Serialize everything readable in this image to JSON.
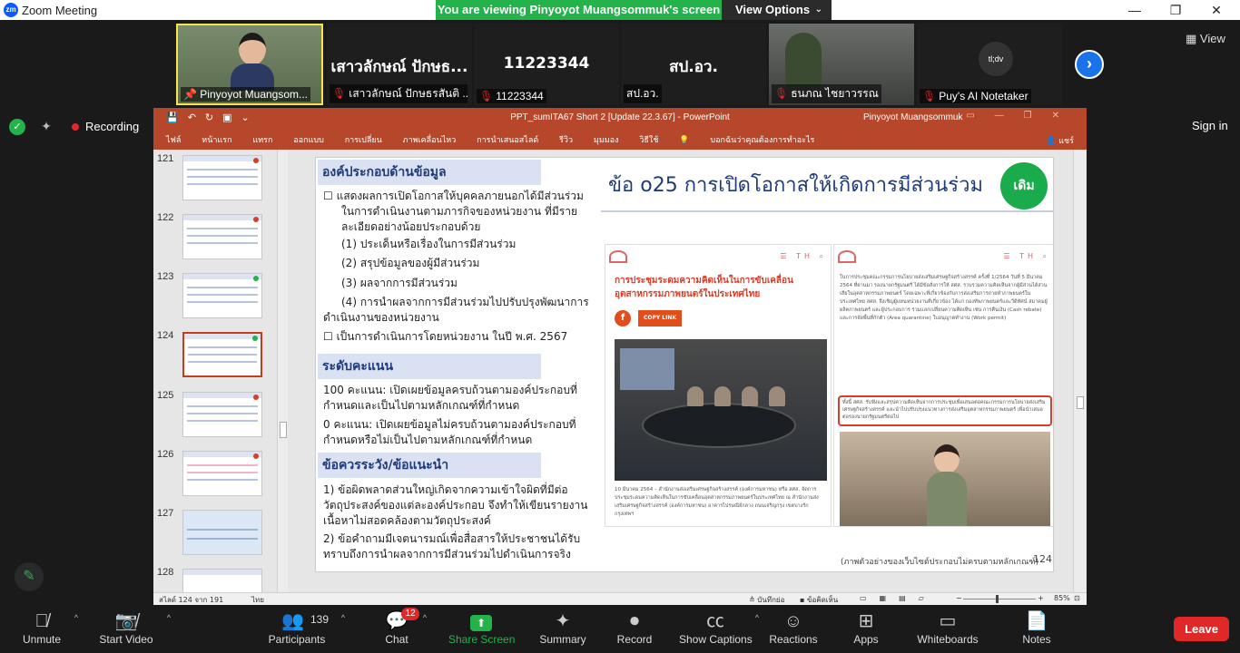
{
  "window": {
    "title": "Zoom Meeting",
    "app_icon": "zm",
    "viewing_banner": "You are viewing Pinyoyot Muangsommuk's screen",
    "view_options": "View Options"
  },
  "participants_strip": [
    {
      "name": "Pinyoyot Muangsom...",
      "big_name": "",
      "muted": false
    },
    {
      "name": "เสาวลักษณ์ ปักษธรสันติ ...",
      "big_name": "เสาวลักษณ์ ปักษธ...",
      "muted": true
    },
    {
      "name": "11223344",
      "big_name": "11223344",
      "muted": true
    },
    {
      "name": "สป.อว.",
      "big_name": "สป.อว.",
      "muted": false
    },
    {
      "name": "ธนภณ ไชยาวรรณ",
      "big_name": "",
      "muted": true
    },
    {
      "name": "Puy's AI Notetaker",
      "big_name": "",
      "muted": true,
      "avatar_text": "tl;dv"
    }
  ],
  "view_button": "View",
  "recording_label": "Recording",
  "sign_in": "Sign in",
  "powerpoint": {
    "doc_title": "PPT_sumITA67 Short 2 [Update 22.3.67]  -  PowerPoint",
    "user": "Pinyoyot Muangsommuk",
    "ribbon_tabs": [
      "ไฟล์",
      "หน้าแรก",
      "แทรก",
      "ออกแบบ",
      "การเปลี่ยน",
      "ภาพเคลื่อนไหว",
      "การนำเสนอสไลด์",
      "รีวิว",
      "มุมมอง",
      "วิธีใช้",
      "บอกฉันว่าคุณต้องการทำอะไร"
    ],
    "share_label": "แชร์",
    "thumbnails": [
      {
        "num": "121",
        "mark": "#d63e2a"
      },
      {
        "num": "122",
        "mark": "#d63e2a"
      },
      {
        "num": "123",
        "mark": "#24b34b"
      },
      {
        "num": "124",
        "mark": "#24b34b",
        "selected": true
      },
      {
        "num": "125",
        "mark": "#d63e2a"
      },
      {
        "num": "126",
        "mark": "#d63e2a"
      },
      {
        "num": "127",
        "mark": ""
      },
      {
        "num": "128",
        "mark": ""
      }
    ],
    "status": {
      "slide_count": "สไลด์ 124 จาก 191",
      "language": "ไทย",
      "notes": "บันทึกย่อ",
      "comments": "ข้อคิดเห็น",
      "zoom": "85%"
    }
  },
  "slide": {
    "left": {
      "components_heading": "องค์ประกอบด้านข้อมูล",
      "item1": "แสดงผลการเปิดโอกาสให้บุคคลภายนอกได้มีส่วนร่วมในการดำเนินงานตามภารกิจของหน่วยงาน ที่มีรายละเอียดอย่างน้อยประกอบด้วย",
      "sub1": "(1) ประเด็นหรือเรื่องในการมีส่วนร่วม",
      "sub2": "(2) สรุปข้อมูลของผู้มีส่วนร่วม",
      "sub3": "(3) ผลจากการมีส่วนร่วม",
      "sub4": "(4) การนำผลจากการมีส่วนร่วมไปปรับปรุงพัฒนาการดำเนินงานของหน่วยงาน",
      "item2": "เป็นการดำเนินการโดยหน่วยงาน ในปี พ.ศ. 2567",
      "score_heading": "ระดับคะแนน",
      "score100": "100 คะแนน: เปิดเผยข้อมูลครบถ้วนตามองค์ประกอบที่กำหนดและเป็นไปตามหลักเกณฑ์ที่กำหนด",
      "score0": "0 คะแนน: เปิดเผยข้อมูลไม่ครบถ้วนตามองค์ประกอบที่กำหนดหรือไม่เป็นไปตามหลักเกณฑ์ที่กำหนด",
      "caution_heading": "ข้อควรระวัง/ข้อแนะนำ",
      "caution1": "1) ข้อผิดพลาดส่วนใหญ่เกิดจากความเข้าใจผิดที่มีต่อวัตถุประสงค์ของแต่ละองค์ประกอบ จึงทำให้เขียนรายงานเนื้อหาไม่สอดคล้องตามวัตถุประสงค์",
      "caution2": "2) ข้อคำถามมีเจตนารมณ์เพื่อสื่อสารให้ประชาชนได้รับทราบถึงการนำผลจากการมีส่วนร่วมไปดำเนินการจริง"
    },
    "right": {
      "title": "ข้อ o25 การเปิดโอกาสให้เกิดการมีส่วนร่วม",
      "badge": "เดิม",
      "web1_title": "การประชุมระดมความคิดเห็นในการขับเคลื่อนอุตสาหกรรมภาพยนตร์ในประเทศไทย",
      "copy_link": "COPY LINK",
      "web1_caption": "10 มีนาคม 2564 – สำนักงานส่งเสริมเศรษฐกิจสร้างสรรค์ (องค์การมหาชน) หรือ สศส. จัดการประชุมระดมความคิดเห็นในการขับเคลื่อนอุตสาหกรรมภาพยนตร์ในประเทศไทย ณ สำนักงานส่งเสริมเศรษฐกิจสร้างสรรค์ (องค์การมหาชน) อาคารไปรษณีย์กลาง ถนนเจริญกรุง เขตบางรัก กรุงเทพฯ",
      "web2_text": "ในการประชุมคณะกรรมการนโยบายส่งเสริมเศรษฐกิจสร้างสรรค์ ครั้งที่ 1/2564 วันที่ 5 มีนาคม 2564 ที่ผ่านมา รองนายกรัฐมนตรี ได้มีข้อสั่งการให้ สศส. รวบรวมความคิดเห็นจากผู้มีส่วนได้ส่วนเสียในอุตสาหกรรมภาพยนตร์ โดยเฉพาะที่เกี่ยวข้องกับการส่งเสริมการถ่ายทำภาพยนตร์ในประเทศไทย สศส. จึงเชิญผู้แทนหน่วยงานที่เกี่ยวข้อง ได้แก่ กองทัพภาพยนตร์และวีดิทัศน์ สมาคมผู้ผลิตภาพยนตร์ และผู้ประกอบการ ร่วมแลกเปลี่ยนความคิดเห็น เช่น การคืนเงิน (Cash rebate) และการจัดพื้นที่กักตัว (Area quarantine) ใบอนุญาตทำงาน (Work permit)",
      "web2_highlight": "ทั้งนี้ สศส. รับฟังและสรุปความคิดเห็นจากการประชุมเพื่อเสนอต่อคณะกรรมการนโยบายส่งเสริมเศรษฐกิจสร้างสรรค์ และนำไปปรับปรุงแนวทางการส่งเสริมอุตสาหกรรมภาพยนตร์ เพื่อนำเสนอต่อรองนายกรัฐมนตรีต่อไป",
      "footer": "(ภาพตัวอย่างของเว็บไซต์ประกอบไม่ครบตามหลักเกณฑ์)",
      "page_number": "124"
    }
  },
  "toolbar": {
    "unmute": "Unmute",
    "start_video": "Start Video",
    "participants": "Participants",
    "participants_count": "139",
    "chat": "Chat",
    "chat_badge": "12",
    "share_screen": "Share Screen",
    "summary": "Summary",
    "record": "Record",
    "captions": "Show Captions",
    "reactions": "Reactions",
    "apps": "Apps",
    "whiteboards": "Whiteboards",
    "notes": "Notes",
    "leave": "Leave"
  },
  "colors": {
    "zoom_green": "#24b34b",
    "ppt_red": "#b7472a",
    "leave_red": "#e02828",
    "slide_heading_bg": "#d9e1f2",
    "slide_heading_text": "#1f3b7a"
  }
}
